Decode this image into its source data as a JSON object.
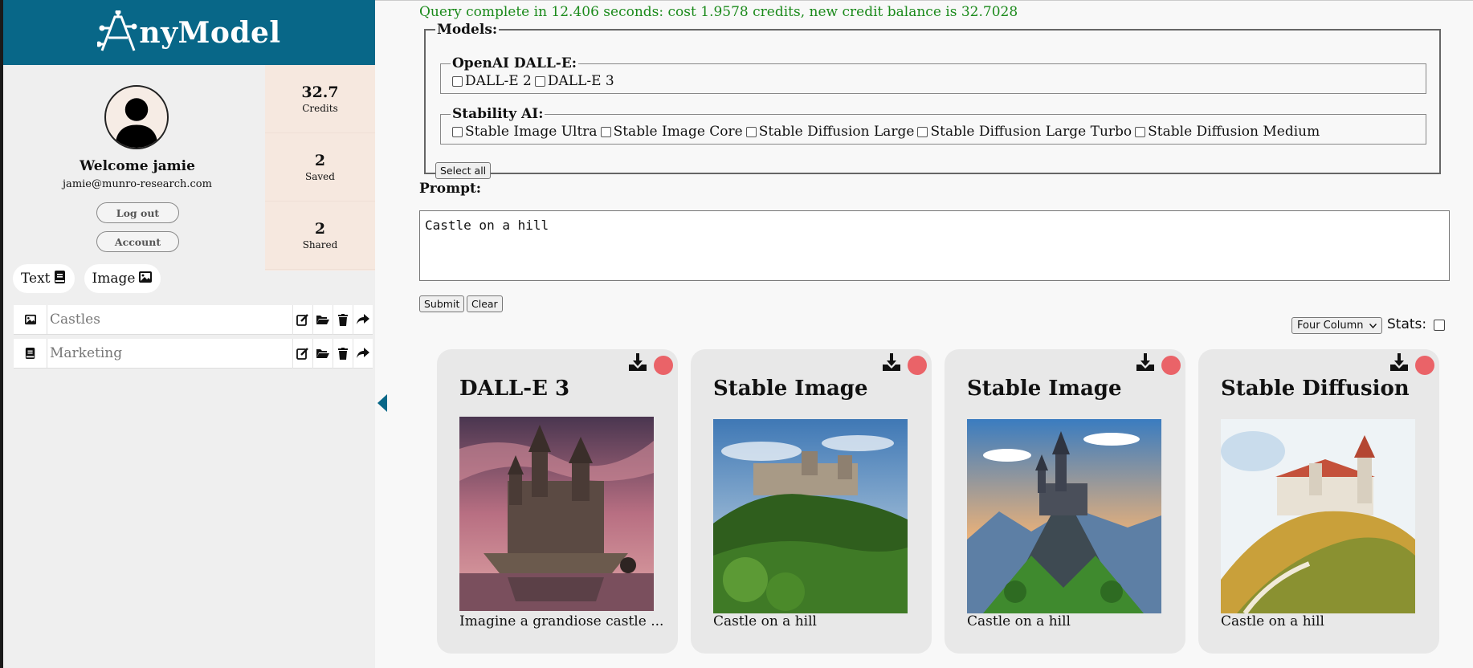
{
  "app": {
    "brand_rest": "nyModel",
    "brand_color": "#086788"
  },
  "user": {
    "welcome": "Welcome jamie",
    "email": "jamie@munro-research.com",
    "logout_label": "Log out",
    "account_label": "Account"
  },
  "stats": [
    {
      "value": "32.7",
      "label": "Credits"
    },
    {
      "value": "2",
      "label": "Saved"
    },
    {
      "value": "2",
      "label": "Shared"
    }
  ],
  "mode_tabs": [
    {
      "label": "Text",
      "icon": "book-icon"
    },
    {
      "label": "Image",
      "icon": "image-icon"
    }
  ],
  "folders": [
    {
      "name": "Castles",
      "icon": "image-icon"
    },
    {
      "name": "Marketing",
      "icon": "book-icon"
    }
  ],
  "status_message": "Query complete in 12.406 seconds: cost 1.9578 credits, new credit balance is 32.7028",
  "models": {
    "legend": "Models:",
    "groups": [
      {
        "legend": "OpenAI DALL-E:",
        "options": [
          "DALL-E 2",
          "DALL-E 3"
        ]
      },
      {
        "legend": "Stability AI:",
        "options": [
          "Stable Image Ultra",
          "Stable Image Core",
          "Stable Diffusion Large",
          "Stable Diffusion Large Turbo",
          "Stable Diffusion Medium"
        ]
      }
    ],
    "select_all_label": "Select all"
  },
  "prompt": {
    "label": "Prompt:",
    "value": "Castle on a hill",
    "submit_label": "Submit",
    "clear_label": "Clear"
  },
  "view": {
    "layout_value": "Four Column",
    "stats_label": "Stats:"
  },
  "results": [
    {
      "title": "DALL-E 3",
      "caption": "Imagine a grandiose castle ..."
    },
    {
      "title": "Stable Image",
      "caption": "Castle on a hill"
    },
    {
      "title": "Stable Image",
      "caption": "Castle on a hill"
    },
    {
      "title": "Stable Diffusion",
      "caption": "Castle on a hill"
    }
  ]
}
